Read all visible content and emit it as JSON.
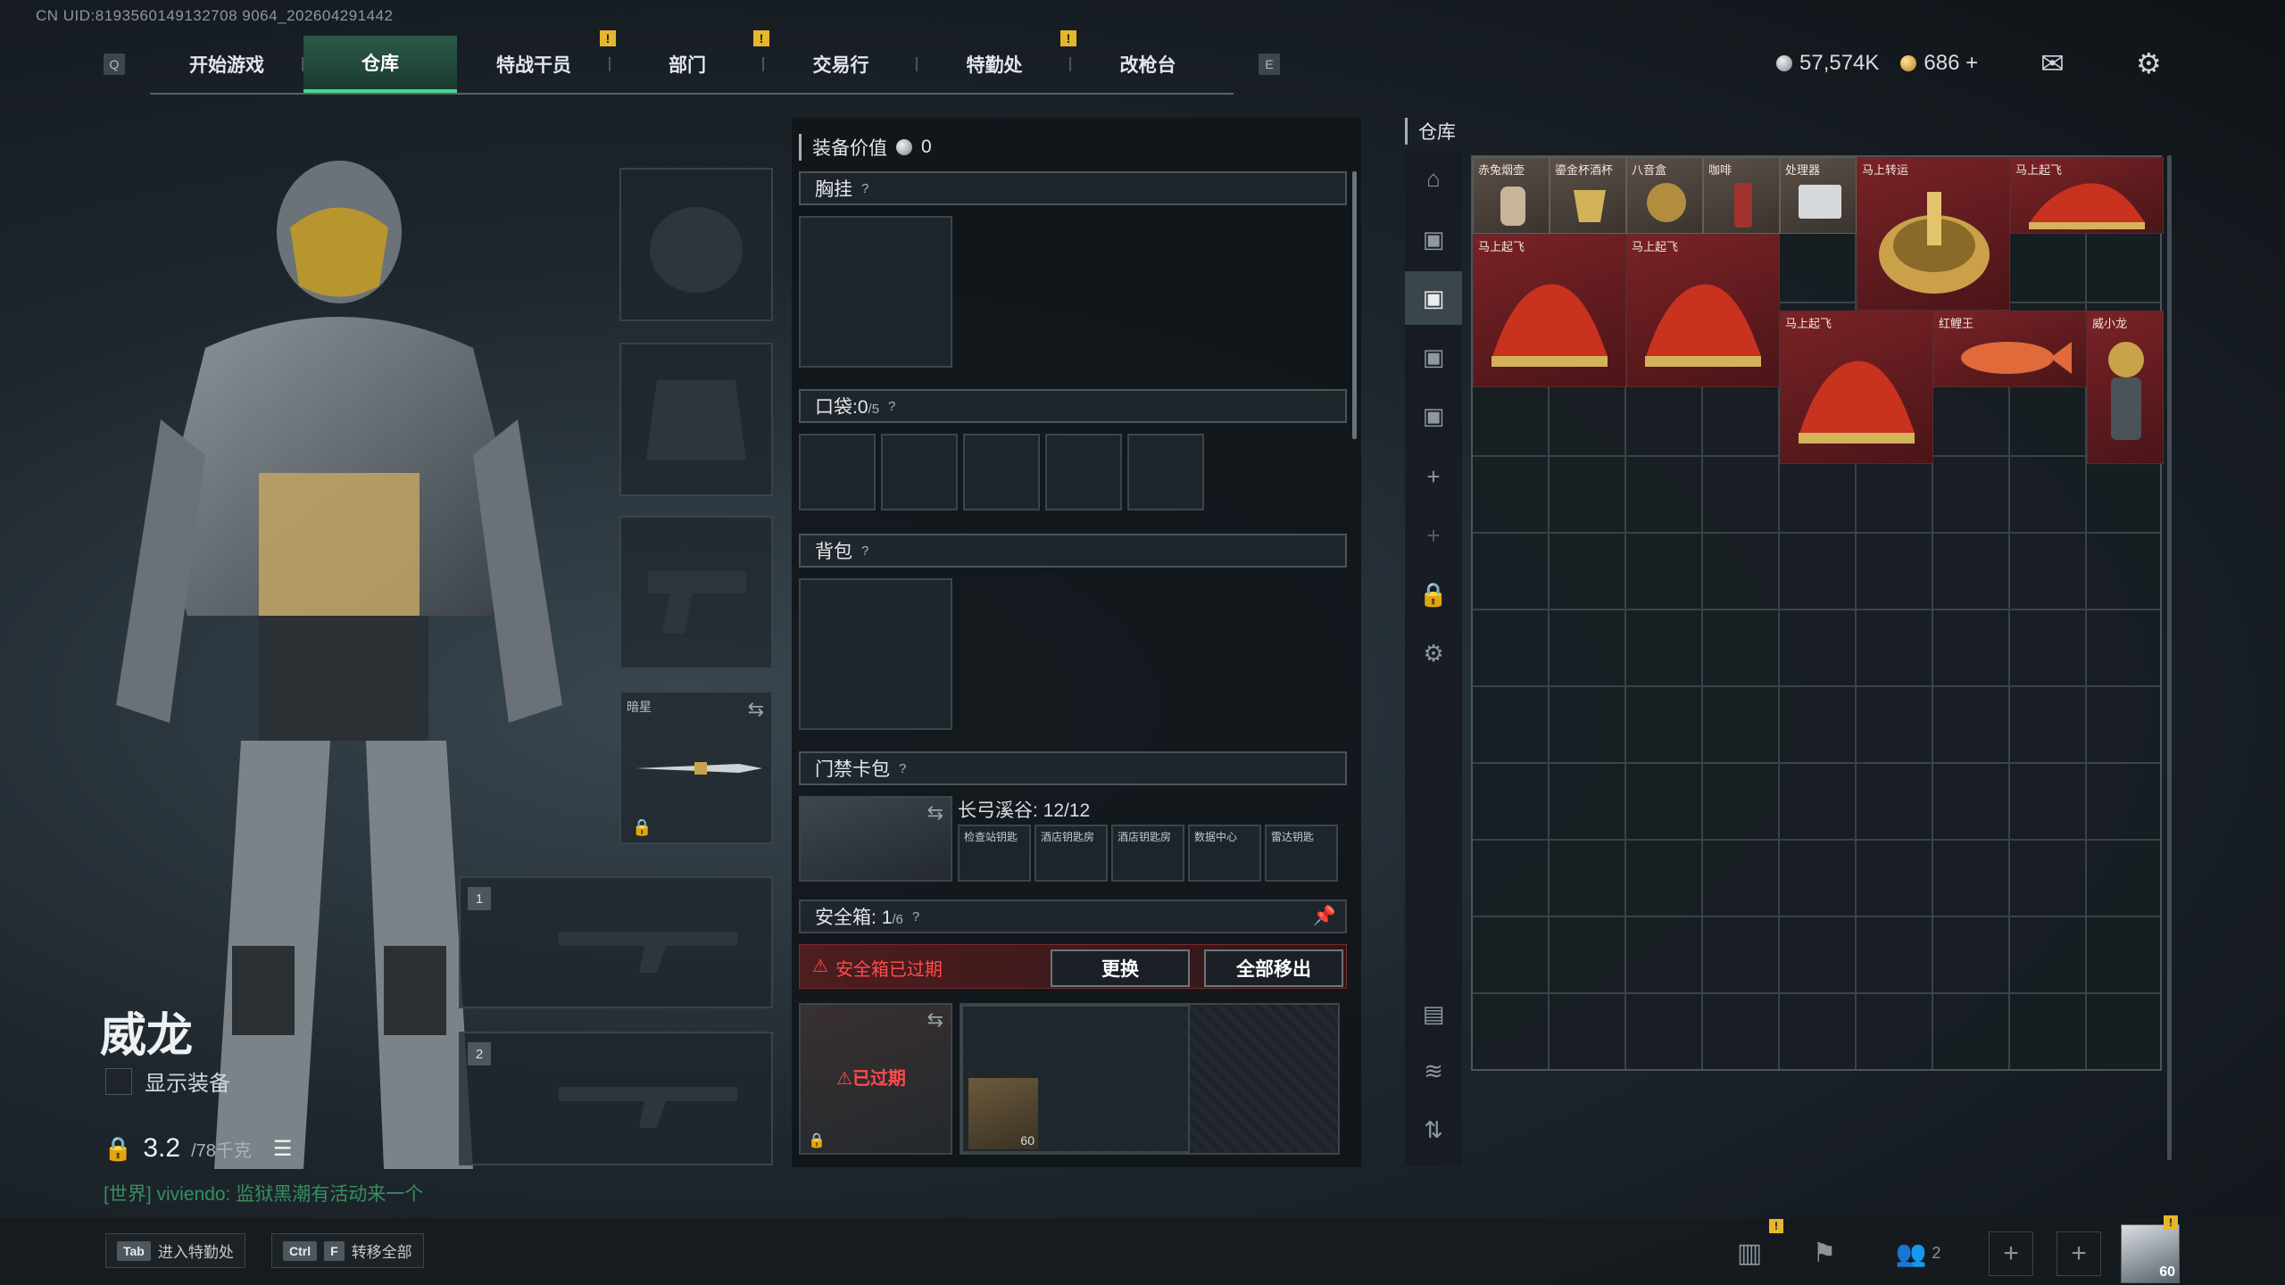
{
  "uid": "CN UID:8193560149132708 9064_202604291442",
  "nav": {
    "left_key": "Q",
    "right_key": "E",
    "tabs": [
      {
        "label": "开始游戏",
        "badge": ""
      },
      {
        "label": "仓库",
        "badge": ""
      },
      {
        "label": "特战干员",
        "badge": "!"
      },
      {
        "label": "部门",
        "badge": "!"
      },
      {
        "label": "交易行",
        "badge": ""
      },
      {
        "label": "特勤处",
        "badge": "!"
      },
      {
        "label": "改枪台",
        "badge": ""
      }
    ],
    "active": "仓库"
  },
  "currency": {
    "silver": "57,574K",
    "gold": "686",
    "plus": "+"
  },
  "operator": {
    "name": "威龙",
    "show_gear_label": "显示装备",
    "weight": "3.2",
    "weight_max": "/78千克",
    "chat": "[世界] viviendo: 监狱黑潮有活动来一个"
  },
  "equip_slots": {
    "melee_label": "暗星",
    "weapon1_num": "1",
    "weapon2_num": "2"
  },
  "mid": {
    "gear_value_label": "装备价值",
    "gear_value": "0",
    "chest_label": "胸挂",
    "pocket_label": "口袋:",
    "pocket_value": "0",
    "pocket_max": "/5",
    "backpack_label": "背包",
    "keycard_label": "门禁卡包",
    "keycard_name": "长弓溪谷: 12/12",
    "keycards": [
      "检查站钥匙",
      "酒店钥匙房",
      "酒店钥匙房",
      "数据中心",
      "雷达钥匙"
    ],
    "safebox_label": "安全箱:",
    "safebox_value": "1",
    "safebox_max": "/6",
    "expired_warning": "安全箱已过期",
    "replace_button": "更换",
    "remove_all_button": "全部移出",
    "expired_tag": "已过期",
    "safebox_item_count": "60",
    "help": "?"
  },
  "stash": {
    "title": "仓库",
    "items": [
      {
        "label": "赤兔烟壶",
        "tone": "gray"
      },
      {
        "label": "鎏金杯酒杯",
        "tone": "gray"
      },
      {
        "label": "八音盒",
        "tone": "gray"
      },
      {
        "label": "咖啡",
        "tone": "gray"
      },
      {
        "label": "处理器",
        "tone": "gray"
      },
      {
        "label": "马上转运",
        "tone": "red"
      },
      {
        "label": "马上起飞",
        "tone": "red"
      },
      {
        "label": "马上起飞",
        "tone": "red"
      },
      {
        "label": "马上起飞",
        "tone": "red"
      },
      {
        "label": "马上起飞",
        "tone": "red"
      },
      {
        "label": "红鲤王",
        "tone": "red"
      },
      {
        "label": "威小龙",
        "tone": "red"
      }
    ]
  },
  "bottom": {
    "hint1_key": "Tab",
    "hint1_label": "进入特勤处",
    "hint2_key1": "Ctrl",
    "hint2_key2": "F",
    "hint2_label": "转移全部",
    "friends_count": "2",
    "level": "60"
  },
  "colors": {
    "accent": "#45d78f",
    "warning": "#e6b62c",
    "danger": "#e0393b"
  }
}
